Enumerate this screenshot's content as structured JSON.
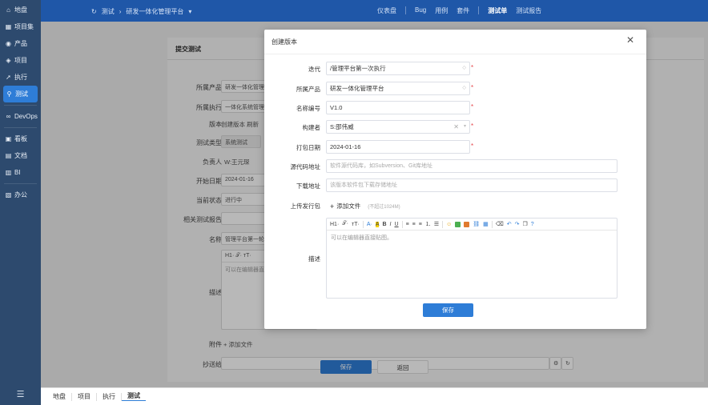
{
  "sidebar": {
    "items": [
      {
        "label": "地盘",
        "icon": "home-icon",
        "glyph": "⌂"
      },
      {
        "label": "项目集",
        "icon": "grid-icon",
        "glyph": "▦"
      },
      {
        "label": "产品",
        "icon": "pin-icon",
        "glyph": "◉"
      },
      {
        "label": "项目",
        "icon": "layers-icon",
        "glyph": "◈"
      },
      {
        "label": "执行",
        "icon": "run-icon",
        "glyph": "➚"
      },
      {
        "label": "测试",
        "icon": "search-icon",
        "glyph": "⚲",
        "active": true
      },
      {
        "label": "DevOps",
        "icon": "infinity-icon",
        "glyph": "∞"
      },
      {
        "label": "看板",
        "icon": "board-icon",
        "glyph": "▣"
      },
      {
        "label": "文档",
        "icon": "doc-icon",
        "glyph": "▤"
      },
      {
        "label": "BI",
        "icon": "bi-icon",
        "glyph": "▥"
      },
      {
        "label": "办公",
        "icon": "office-icon",
        "glyph": "▧"
      }
    ],
    "menu_glyph": "☰"
  },
  "topbar": {
    "crumb_home": "测试",
    "crumb_product": "研发一体化管理平台",
    "nav": [
      "仪表盘",
      "Bug",
      "用例",
      "套件",
      "测试单",
      "测试报告"
    ],
    "current": "测试单"
  },
  "background": {
    "panel_title": "提交测试",
    "fields": [
      {
        "label": "所属产品",
        "value": "研发一体化管理"
      },
      {
        "label": "所属执行",
        "value": "一体化系统管理"
      },
      {
        "label": "版本",
        "value": "创建版本  刷新"
      },
      {
        "label": "测试类型",
        "value": "系统测试"
      },
      {
        "label": "负责人",
        "value": "W:王元琛"
      },
      {
        "label": "开始日期",
        "value": "2024-01-16"
      },
      {
        "label": "当前状态",
        "value": "进行中"
      },
      {
        "label": "相关测试报告",
        "value": ""
      },
      {
        "label": "名称",
        "value": "管理平台第一轮"
      },
      {
        "label": "描述",
        "value": ""
      },
      {
        "label": "附件",
        "value": "+ 添加文件"
      },
      {
        "label": "抄送给",
        "value": ""
      }
    ],
    "editor_placeholder": "可以在编辑器直接",
    "editor_toolbar": "H1·  𝒯·  ᴛT·",
    "save": "保存",
    "back": "返回"
  },
  "modal": {
    "title": "创建版本",
    "close": "✕",
    "fields": [
      {
        "label": "迭代",
        "value": "/管理平台第一次执行",
        "type": "select",
        "required": true
      },
      {
        "label": "所属产品",
        "value": "研发一体化管理平台",
        "type": "select",
        "required": true
      },
      {
        "label": "名称编号",
        "value": "V1.0",
        "type": "text",
        "required": true
      },
      {
        "label": "构建者",
        "value": "S:邵伟威",
        "type": "select-clear",
        "required": true
      },
      {
        "label": "打包日期",
        "value": "2024-01-16",
        "type": "text",
        "required": true
      },
      {
        "label": "源代码地址",
        "placeholder": "软件源代码库，如Subversion、Git库地址",
        "type": "text"
      },
      {
        "label": "下载地址",
        "placeholder": "该版本软件包下载存储地址",
        "type": "text"
      },
      {
        "label": "上传发行包",
        "type": "file"
      },
      {
        "label": "描述",
        "type": "editor"
      }
    ],
    "add_file": "添加文件",
    "file_hint": "(不超过1024M)",
    "editor_placeholder": "可以在编辑器直接贴图。",
    "save": "保存"
  },
  "bottombar": {
    "items": [
      "地盘",
      "项目",
      "执行",
      "测试"
    ],
    "current": "测试"
  },
  "colors": {
    "sidebar": "#2d4a6e",
    "topbar": "#1f57a8",
    "accent": "#2e7dd7",
    "required": "#e5484d"
  }
}
